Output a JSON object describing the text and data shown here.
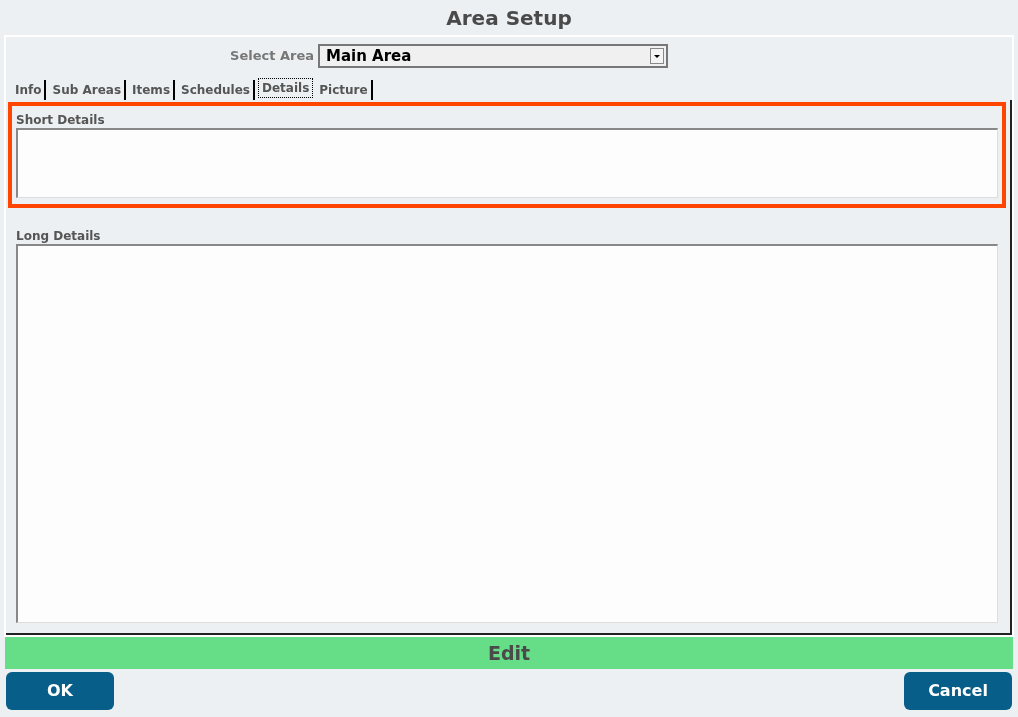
{
  "window": {
    "title": "Area Setup"
  },
  "select_area": {
    "label": "Select Area",
    "value": "Main Area"
  },
  "tabs": [
    {
      "label": "Info",
      "selected": false
    },
    {
      "label": "Sub Areas",
      "selected": false
    },
    {
      "label": "Items",
      "selected": false
    },
    {
      "label": "Schedules",
      "selected": false
    },
    {
      "label": "Details",
      "selected": true
    },
    {
      "label": "Picture",
      "selected": false
    }
  ],
  "fields": [
    {
      "label": "Short Details",
      "kind": "short",
      "highlighted": true
    },
    {
      "label": "Long Details",
      "kind": "long",
      "highlighted": false
    }
  ],
  "mode_bar": {
    "label": "Edit"
  },
  "buttons": [
    "OK",
    "Cancel"
  ]
}
